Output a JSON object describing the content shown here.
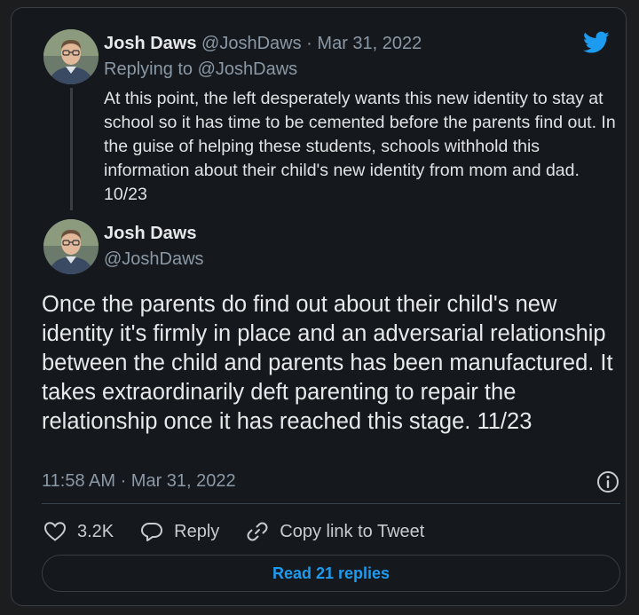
{
  "colors": {
    "accent": "#1d9bf0",
    "muted": "#8b98a5",
    "background": "#15181c"
  },
  "reply_tweet": {
    "author_name": "Josh Daws",
    "handle": "@JoshDaws",
    "separator": "·",
    "date": "Mar 31, 2022",
    "replying_to": "Replying to @JoshDaws",
    "text": "At this point, the left desperately wants this new identity to stay at school so it has time to be cemented before the parents find out. In the guise of helping these students, schools withhold this information about their child's new identity from mom and dad. 10/23"
  },
  "main_tweet": {
    "author_name": "Josh Daws",
    "handle": "@JoshDaws",
    "text": "Once the parents do find out about their child's new identity it's firmly in place and an adversarial relationship between the child and parents has been manufactured. It takes extraordinarily deft parenting to repair the relationship once it has reached this stage. 11/23",
    "timestamp": "11:58 AM · Mar 31, 2022"
  },
  "actions": {
    "like_count": "3.2K",
    "reply_label": "Reply",
    "copy_link_label": "Copy link to Tweet"
  },
  "read_replies_label": "Read 21 replies",
  "icons": [
    "twitter-bird-icon",
    "info-icon",
    "heart-icon",
    "reply-bubble-icon",
    "link-icon"
  ]
}
